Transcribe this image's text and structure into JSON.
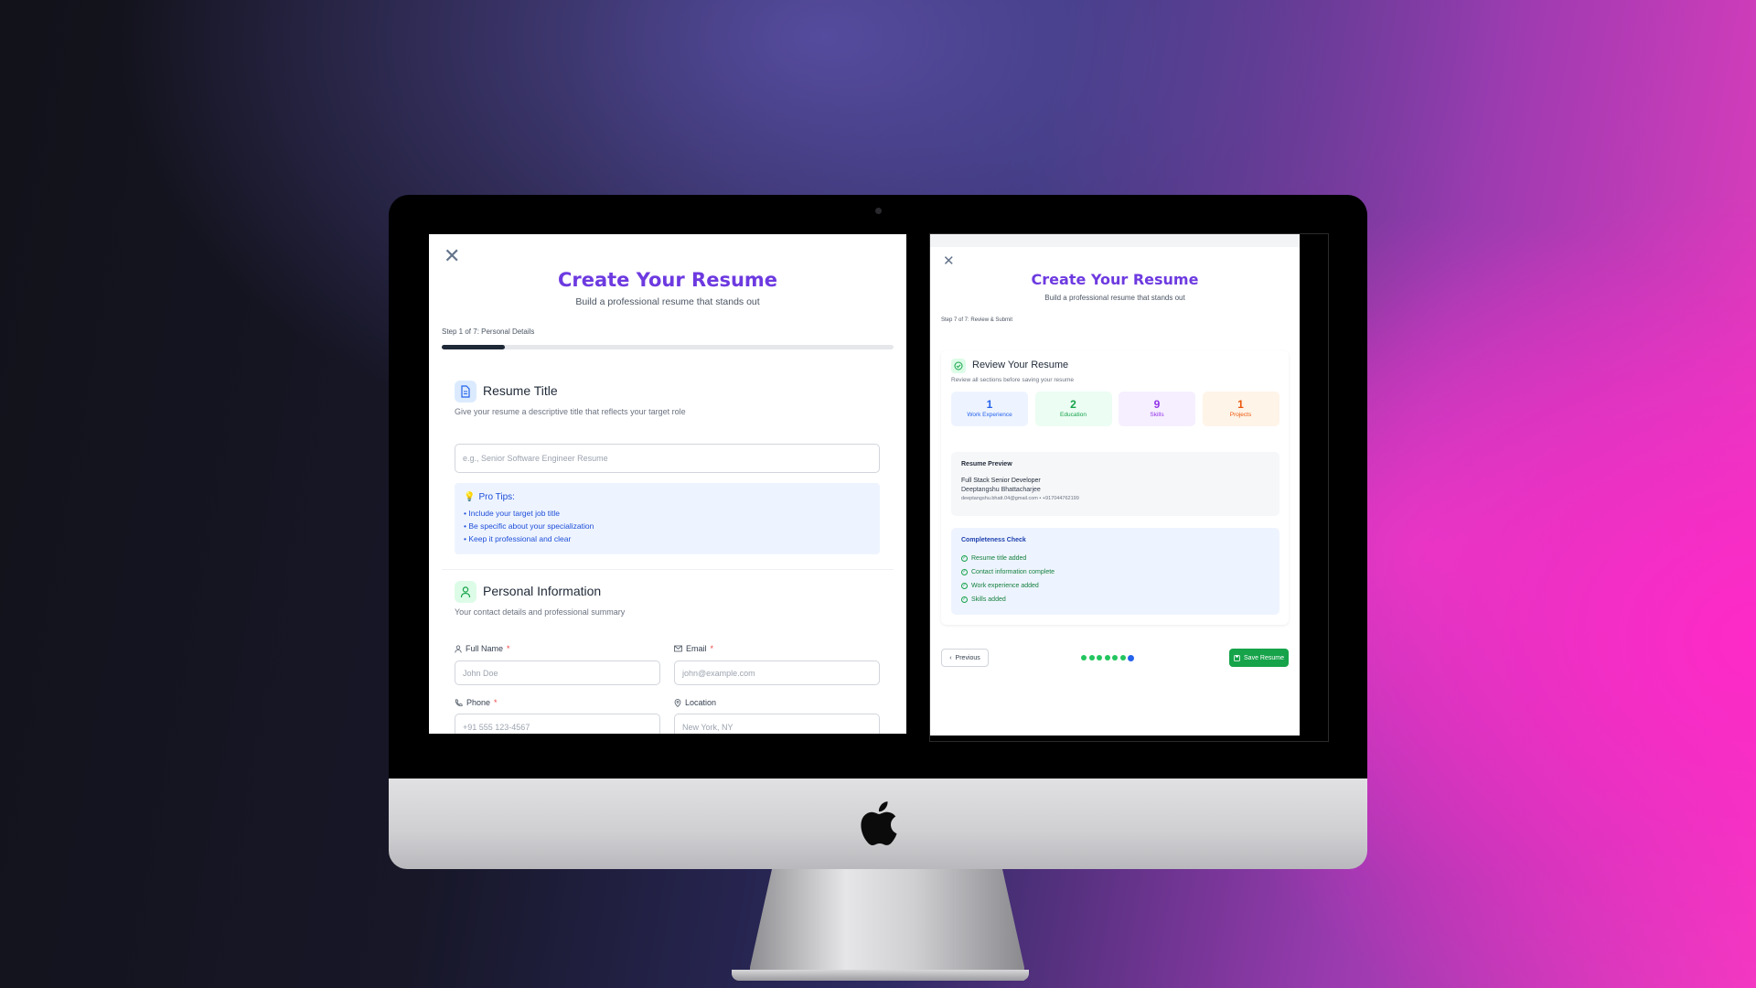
{
  "left_screen": {
    "title": "Create Your Resume",
    "subtitle": "Build a professional resume that stands out",
    "step_text": "Step 1 of 7: Personal Details",
    "progress": 0.14,
    "resume_title_section": {
      "heading": "Resume Title",
      "description": "Give your resume a descriptive title that reflects your target role",
      "input_placeholder": "e.g., Senior Software Engineer Resume",
      "tips_title": "Pro Tips:",
      "tips": [
        "• Include your target job title",
        "• Be specific about your specialization",
        "• Keep it professional and clear"
      ]
    },
    "personal_info_section": {
      "heading": "Personal Information",
      "description": "Your contact details and professional summary",
      "fields": {
        "full_name": {
          "label": "Full Name",
          "required": "*",
          "placeholder": "John Doe"
        },
        "email": {
          "label": "Email",
          "required": "*",
          "placeholder": "john@example.com"
        },
        "phone": {
          "label": "Phone",
          "required": "*",
          "placeholder": "+91 555 123-4567"
        },
        "location": {
          "label": "Location",
          "placeholder": "New York, NY"
        }
      }
    }
  },
  "right_screen": {
    "title": "Create Your Resume",
    "subtitle": "Build a professional resume that stands out",
    "step_text": "Step 7 of 7: Review & Submit",
    "review": {
      "heading": "Review Your Resume",
      "description": "Review all sections before saving your resume",
      "stats": [
        {
          "value": "1",
          "label": "Work Experience",
          "color": "#2563eb",
          "bg": "#eef4ff"
        },
        {
          "value": "2",
          "label": "Education",
          "color": "#16a34a",
          "bg": "#ecfdf3"
        },
        {
          "value": "9",
          "label": "Skills",
          "color": "#9333ea",
          "bg": "#f6efff"
        },
        {
          "value": "1",
          "label": "Projects",
          "color": "#ea580c",
          "bg": "#fff4e8"
        }
      ],
      "preview": {
        "heading": "Resume Preview",
        "resume_title": "Full Stack Senior Developer",
        "name": "Deeptangshu Bhattacharjee",
        "contact": "deeptangshu.bhatt.04@gmail.com • +917044762199"
      },
      "completeness": {
        "heading": "Completeness Check",
        "items": [
          "Resume title added",
          "Contact information complete",
          "Work experience added",
          "Skills added"
        ]
      }
    },
    "nav": {
      "previous_label": "Previous",
      "save_label": "Save Resume",
      "steps_total": 7,
      "current_step": 7
    }
  },
  "colors": {
    "accent_purple": "#6d3ae0",
    "success_green": "#16a34a"
  }
}
